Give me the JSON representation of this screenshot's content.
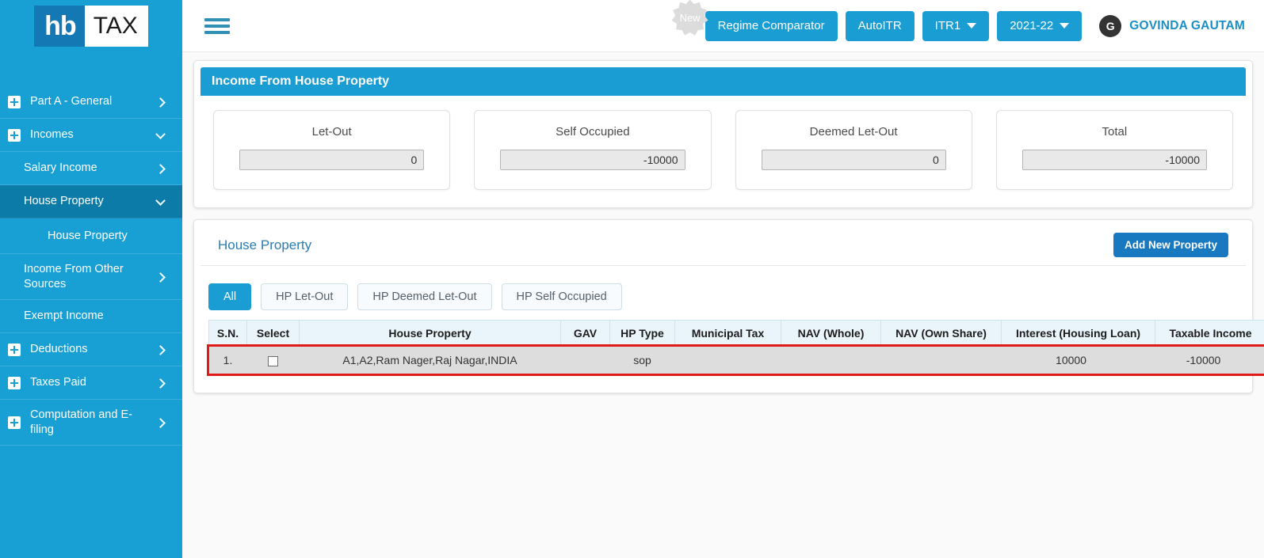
{
  "brand": {
    "logo_left": "hb",
    "logo_right": "TAX"
  },
  "sidebar": {
    "items": [
      {
        "label": "Part A - General",
        "icon": "plus-box-icon",
        "chevron": "chevron-right-icon",
        "level": "top",
        "active": false
      },
      {
        "label": "Incomes",
        "icon": "plus-box-icon",
        "chevron": "chevron-down-icon",
        "level": "top",
        "active": false
      },
      {
        "label": "Salary Income",
        "chevron": "chevron-right-icon",
        "level": "sub",
        "active": false
      },
      {
        "label": "House Property",
        "chevron": "chevron-down-icon",
        "level": "sub",
        "active": true
      },
      {
        "label": "House Property",
        "level": "subsub",
        "active": false
      },
      {
        "label": "Income From Other Sources",
        "chevron": "chevron-right-icon",
        "level": "sub",
        "active": false
      },
      {
        "label": "Exempt Income",
        "level": "sub",
        "active": false
      },
      {
        "label": "Deductions",
        "icon": "plus-box-icon",
        "chevron": "chevron-right-icon",
        "level": "top",
        "active": false
      },
      {
        "label": "Taxes Paid",
        "icon": "plus-box-icon",
        "chevron": "chevron-right-icon",
        "level": "top",
        "active": false
      },
      {
        "label": "Computation and E-filing",
        "icon": "plus-box-icon",
        "chevron": "chevron-right-icon",
        "level": "top",
        "active": false
      }
    ]
  },
  "topbar": {
    "menu_icon": "hamburger-icon",
    "new_badge": "New",
    "regime_comparator": "Regime Comparator",
    "auto_itr": "AutoITR",
    "itr_select": "ITR1",
    "year_select": "2021-22",
    "avatar_initial": "G",
    "user_name": "GOVINDA GAUTAM"
  },
  "income_panel": {
    "title": "Income From House Property",
    "cards": [
      {
        "label": "Let-Out",
        "value": "0"
      },
      {
        "label": "Self Occupied",
        "value": "-10000"
      },
      {
        "label": "Deemed Let-Out",
        "value": "0"
      },
      {
        "label": "Total",
        "value": "-10000"
      }
    ]
  },
  "house_property": {
    "title": "House Property",
    "add_button": "Add New Property",
    "filters": [
      {
        "label": "All",
        "active": true
      },
      {
        "label": "HP Let-Out",
        "active": false
      },
      {
        "label": "HP Deemed Let-Out",
        "active": false
      },
      {
        "label": "HP Self Occupied",
        "active": false
      }
    ],
    "columns": [
      "S.N.",
      "Select",
      "House Property",
      "GAV",
      "HP Type",
      "Municipal Tax",
      "NAV (Whole)",
      "NAV (Own Share)",
      "Interest (Housing Loan)",
      "Taxable Income"
    ],
    "rows": [
      {
        "sn": "1.",
        "select": "",
        "house_property": "A1,A2,Ram Nager,Raj Nagar,INDIA",
        "gav": "",
        "hp_type": "sop",
        "municipal_tax": "",
        "nav_whole": "",
        "nav_own_share": "",
        "interest_housing_loan": "10000",
        "taxable_income": "-10000",
        "highlighted": true
      }
    ]
  },
  "colors": {
    "sidebar": "#189fd4",
    "sidebar_active": "#0d7ba8",
    "accent": "#1a9dd3",
    "button_blue": "#1878c0",
    "highlight_red": "#e01919",
    "table_header": "#e9f4fb"
  }
}
